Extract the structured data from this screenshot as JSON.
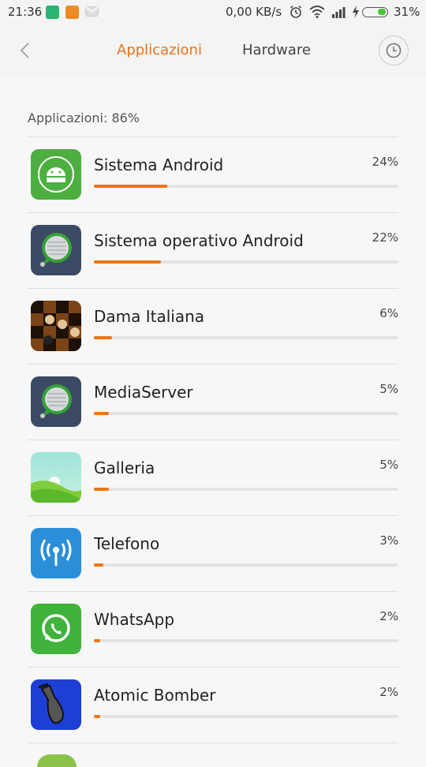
{
  "status_bar": {
    "time": "21:36",
    "network_speed": "0,00 KB/s",
    "battery_percent": "31%",
    "battery_level": 0.31
  },
  "header": {
    "tabs": [
      {
        "label": "Applicazioni",
        "active": true
      },
      {
        "label": "Hardware",
        "active": false
      }
    ],
    "accent_color": "#e8731a"
  },
  "summary": {
    "label": "Applicazioni: 86%"
  },
  "apps": [
    {
      "name": "Sistema Android",
      "percent_label": "24%",
      "percent": 24,
      "icon": "android-system-icon"
    },
    {
      "name": "Sistema operativo Android",
      "percent_label": "22%",
      "percent": 22,
      "icon": "android-os-icon"
    },
    {
      "name": "Dama Italiana",
      "percent_label": "6%",
      "percent": 6,
      "icon": "checkers-icon"
    },
    {
      "name": "MediaServer",
      "percent_label": "5%",
      "percent": 5,
      "icon": "mediaserver-icon"
    },
    {
      "name": "Galleria",
      "percent_label": "5%",
      "percent": 5,
      "icon": "gallery-icon"
    },
    {
      "name": "Telefono",
      "percent_label": "3%",
      "percent": 3,
      "icon": "phone-signal-icon"
    },
    {
      "name": "WhatsApp",
      "percent_label": "2%",
      "percent": 2,
      "icon": "whatsapp-icon"
    },
    {
      "name": "Atomic Bomber",
      "percent_label": "2%",
      "percent": 2,
      "icon": "bomb-icon"
    }
  ]
}
